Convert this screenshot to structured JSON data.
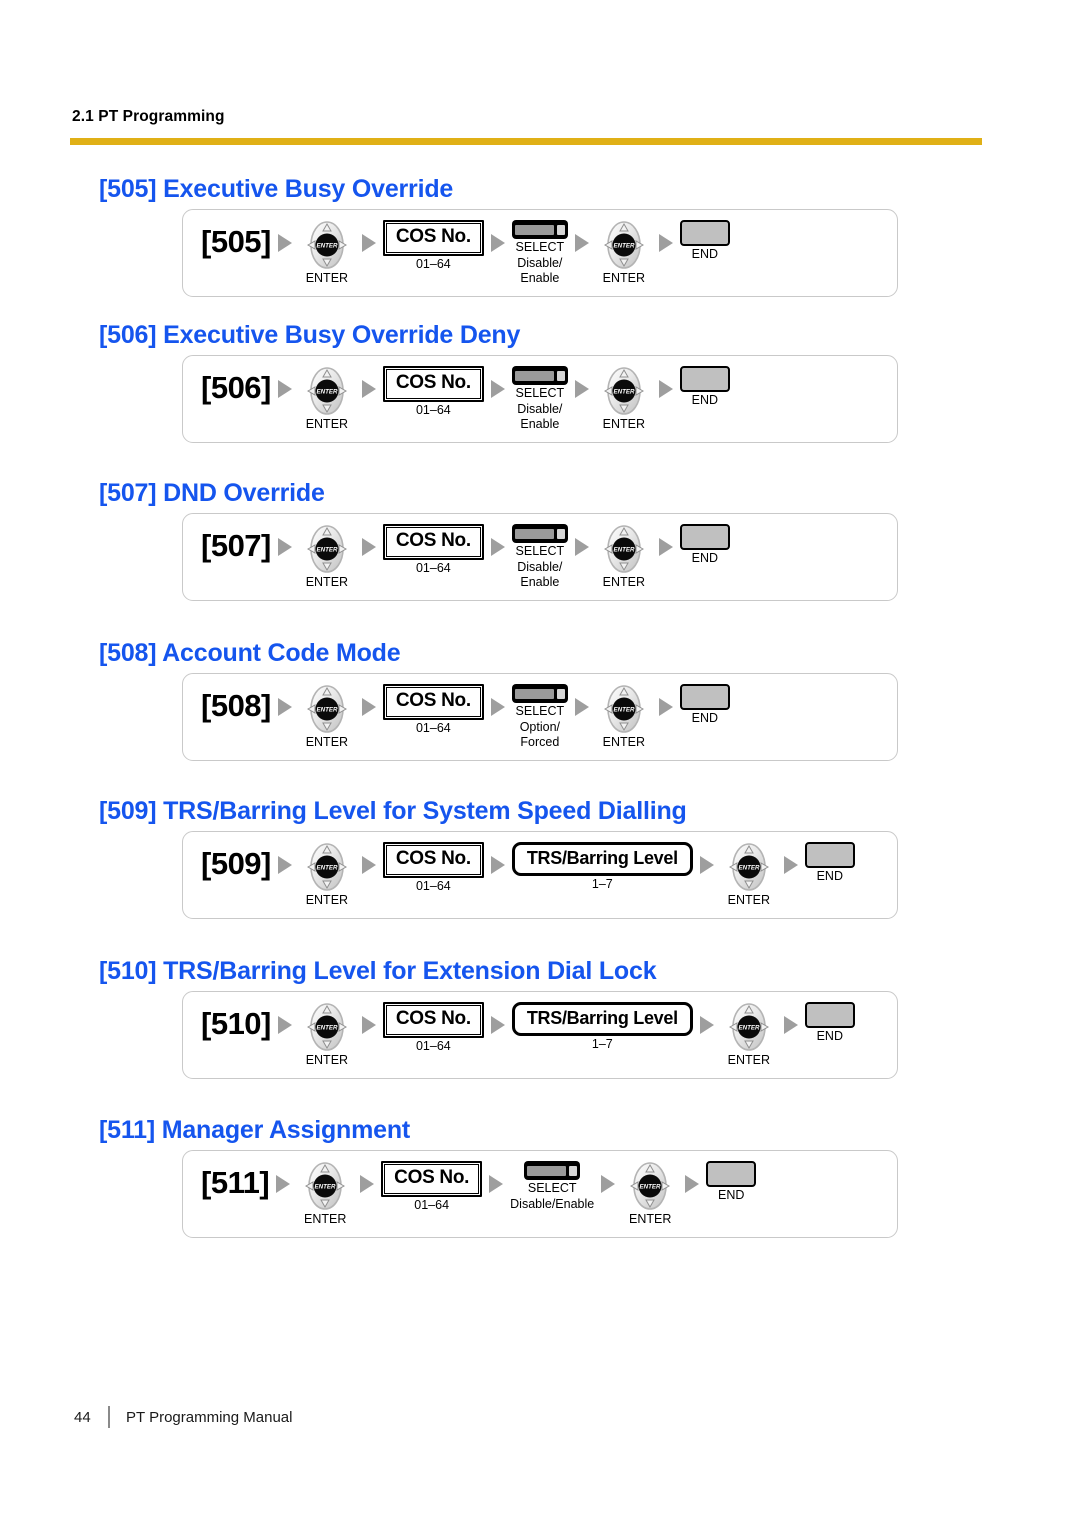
{
  "header": {
    "section_label": "2.1 PT Programming",
    "rule_color": "#E0B016"
  },
  "theme": {
    "heading_color": "#1555EE",
    "frame_border": "#c9c9c9",
    "arrow_color": "#9e9e9e",
    "end_key_fill": "#c0c0c0"
  },
  "labels": {
    "enter": "ENTER",
    "select": "SELECT",
    "end": "END",
    "cos_no": "COS No.",
    "cos_range": "01–64",
    "trs_level": "TRS/Barring Level",
    "trs_range": "1–7"
  },
  "sections": [
    {
      "title": "[505] Executive Busy Override",
      "prog_no": "[505]",
      "enter1_caption": "ENTER",
      "param_type": "keybox",
      "param_label": "COS No.",
      "param_range": "01–64",
      "select_label": "SELECT",
      "select_option_line1": "Disable/",
      "select_option_line2": "Enable",
      "enter2_caption": "ENTER",
      "end_caption": "END"
    },
    {
      "title": "[506] Executive Busy Override Deny",
      "prog_no": "[506]",
      "enter1_caption": "ENTER",
      "param_type": "keybox",
      "param_label": "COS No.",
      "param_range": "01–64",
      "select_label": "SELECT",
      "select_option_line1": "Disable/",
      "select_option_line2": "Enable",
      "enter2_caption": "ENTER",
      "end_caption": "END"
    },
    {
      "title": "[507] DND Override",
      "prog_no": "[507]",
      "enter1_caption": "ENTER",
      "param_type": "keybox",
      "param_label": "COS No.",
      "param_range": "01–64",
      "select_label": "SELECT",
      "select_option_line1": "Disable/",
      "select_option_line2": "Enable",
      "enter2_caption": "ENTER",
      "end_caption": "END"
    },
    {
      "title": "[508] Account Code Mode",
      "prog_no": "[508]",
      "enter1_caption": "ENTER",
      "param_type": "keybox",
      "param_label": "COS No.",
      "param_range": "01–64",
      "select_label": "SELECT",
      "select_option_line1": "Option/",
      "select_option_line2": "Forced",
      "enter2_caption": "ENTER",
      "end_caption": "END"
    },
    {
      "title": "[509] TRS/Barring Level for System Speed Dialling",
      "prog_no": "[509]",
      "enter1_caption": "ENTER",
      "param_type": "keybox",
      "param_label": "COS No.",
      "param_range": "01–64",
      "second_box_label": "TRS/Barring Level",
      "second_box_range": "1–7",
      "enter2_caption": "ENTER",
      "end_caption": "END"
    },
    {
      "title": "[510] TRS/Barring Level for Extension Dial Lock",
      "prog_no": "[510]",
      "enter1_caption": "ENTER",
      "param_type": "keybox",
      "param_label": "COS No.",
      "param_range": "01–64",
      "second_box_label": "TRS/Barring Level",
      "second_box_range": "1–7",
      "enter2_caption": "ENTER",
      "end_caption": "END"
    },
    {
      "title": "[511] Manager Assignment",
      "prog_no": "[511]",
      "enter1_caption": "ENTER",
      "param_type": "keybox",
      "param_label": "COS No.",
      "param_range": "01–64",
      "select_label": "SELECT",
      "select_option_line1": "Disable/Enable",
      "select_option_line2": "",
      "enter2_caption": "ENTER",
      "end_caption": "END"
    }
  ],
  "footer": {
    "page_number": "44",
    "document_title": "PT Programming Manual"
  }
}
